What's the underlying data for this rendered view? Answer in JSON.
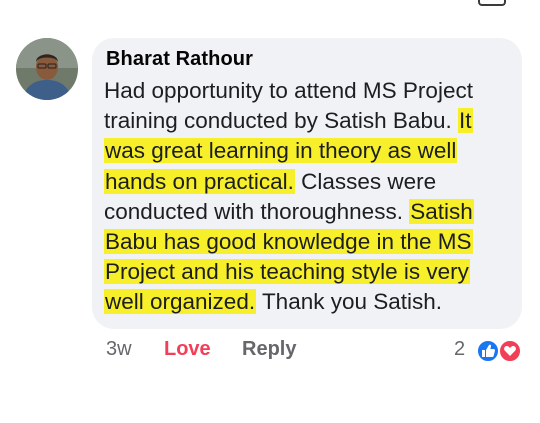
{
  "comment": {
    "author": "Bharat Rathour",
    "lines": [
      [
        {
          "t": "Had opportunity to attend MS Project",
          "h": false
        }
      ],
      [
        {
          "t": "training conducted by Satish Babu. ",
          "h": false
        },
        {
          "t": "It",
          "h": true
        }
      ],
      [
        {
          "t": "was great learning in theory as well",
          "h": true
        }
      ],
      [
        {
          "t": "hands on practical.",
          "h": true
        },
        {
          "t": " Classes were",
          "h": false
        }
      ],
      [
        {
          "t": "conducted with thoroughness. ",
          "h": false
        },
        {
          "t": "Satish",
          "h": true
        }
      ],
      [
        {
          "t": "Babu has good knowledge in the MS",
          "h": true
        }
      ],
      [
        {
          "t": "Project and his teaching style is very",
          "h": true
        }
      ],
      [
        {
          "t": "well organized.",
          "h": true
        },
        {
          "t": " Thank you Satish.",
          "h": false
        }
      ]
    ]
  },
  "actions": {
    "time": "3w",
    "love": "Love",
    "reply": "Reply"
  },
  "reactions": {
    "count": "2",
    "icons": [
      "like-icon",
      "love-icon"
    ]
  },
  "colors": {
    "highlight": "#f7ef2a",
    "love_active": "#f33e58",
    "like_blue": "#1877f2",
    "bubble_bg": "#f0f2f5"
  }
}
